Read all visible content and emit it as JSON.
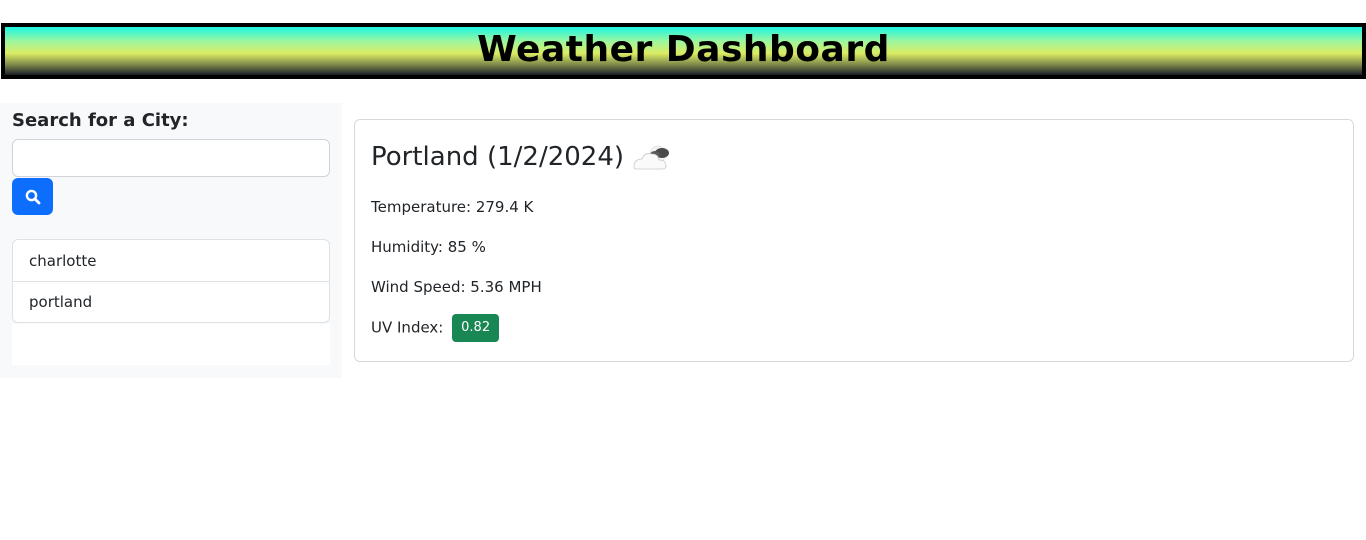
{
  "header": {
    "title": "Weather Dashboard"
  },
  "sidebar": {
    "search_label": "Search for a City:",
    "search_value": "",
    "search_placeholder": "",
    "search_button_icon": "search-icon",
    "history": [
      {
        "label": "charlotte"
      },
      {
        "label": "portland"
      }
    ]
  },
  "current": {
    "city": "Portland",
    "date": "(1/2/2024)",
    "icon": "partly-cloudy-icon",
    "temperature": "Temperature: 279.4 K",
    "humidity": "Humidity: 85 %",
    "wind": "Wind Speed: 5.36 MPH",
    "uv_label": "UV Index:",
    "uv_value": "0.82"
  },
  "colors": {
    "accent": "#0d6efd",
    "uv_badge": "#198754",
    "sidebar_bg": "#f8f9fa"
  }
}
